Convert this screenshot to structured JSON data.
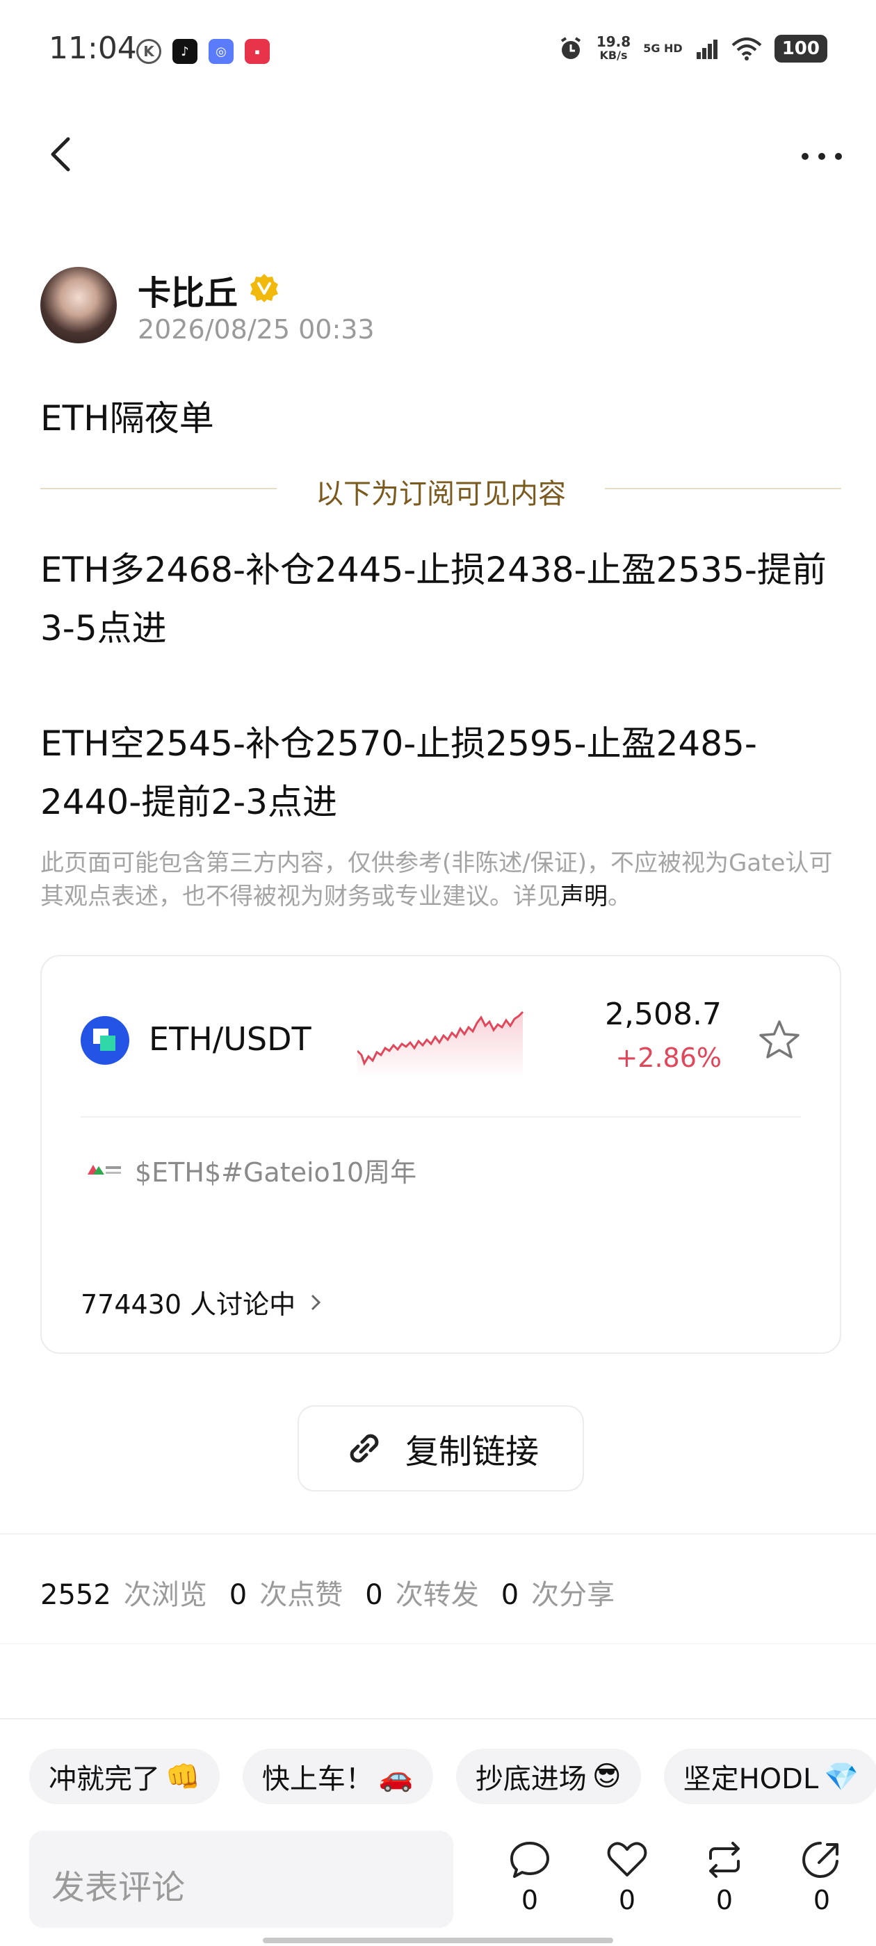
{
  "status_bar": {
    "time": "11:04",
    "speed_value": "19.8",
    "speed_unit": "KB/s",
    "network": "5G HD",
    "battery": "100"
  },
  "author": {
    "name": "卡比丘",
    "time": "2026/08/25 00:33"
  },
  "post": {
    "title": "ETH隔夜单",
    "divider_text": "以下为订阅可见内容",
    "paragraph1": "ETH多2468-补仓2445-止损2438-止盈2535-提前3-5点进",
    "paragraph2": "ETH空2545-补仓2570-止损2595-止盈2485-2440-提前2-3点进",
    "disclaimer": "此页面可能包含第三方内容，仅供参考(非陈述/保证)，不应被视为Gate认可其观点表述，也不得被视为财务或专业建议。详见",
    "disclaimer_link": "声明",
    "disclaimer_end": "。"
  },
  "market_card": {
    "pair": "ETH/USDT",
    "price": "2,508.7",
    "change": "+2.86%",
    "change_color": "#e0475b",
    "tags": "$ETH$#Gateio10周年",
    "discussion": "774430 人讨论中"
  },
  "copy_link_label": "复制链接",
  "stats": {
    "views": "2552",
    "views_label": "次浏览",
    "likes": "0",
    "likes_label": "次点赞",
    "reposts": "0",
    "reposts_label": "次转发",
    "shares": "0",
    "shares_label": "次分享"
  },
  "quick_replies": [
    {
      "text": "冲就完了",
      "emoji": "👊"
    },
    {
      "text": "快上车！",
      "emoji": "🚗"
    },
    {
      "text": "抄底进场",
      "emoji": "😎"
    },
    {
      "text": "坚定HODL",
      "emoji": "💎"
    }
  ],
  "bottom_bar": {
    "comment_placeholder": "发表评论",
    "comment_count": "0",
    "like_count": "0",
    "repost_count": "0",
    "share_count": "0"
  }
}
